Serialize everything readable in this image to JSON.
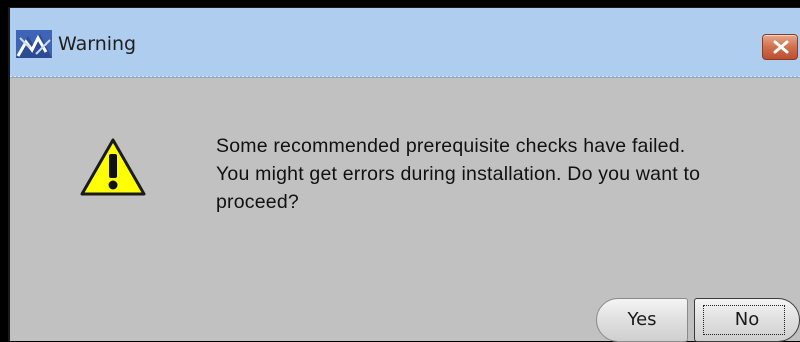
{
  "window": {
    "title": "Warning",
    "app_icon": "installer-logo-icon",
    "close_icon": "close-icon",
    "close_color": "#cf6f4e",
    "titlebar_color": "#aecdef",
    "background_color": "#c1c1c1"
  },
  "dialog": {
    "icon": "warning-triangle-icon",
    "icon_color": "#ffff00",
    "message_lines": [
      "Some recommended prerequisite checks have failed.",
      "You might get errors during installation. Do you want to",
      "proceed?"
    ],
    "buttons": {
      "yes_label": "Yes",
      "no_label": "No",
      "focused": "No"
    }
  }
}
